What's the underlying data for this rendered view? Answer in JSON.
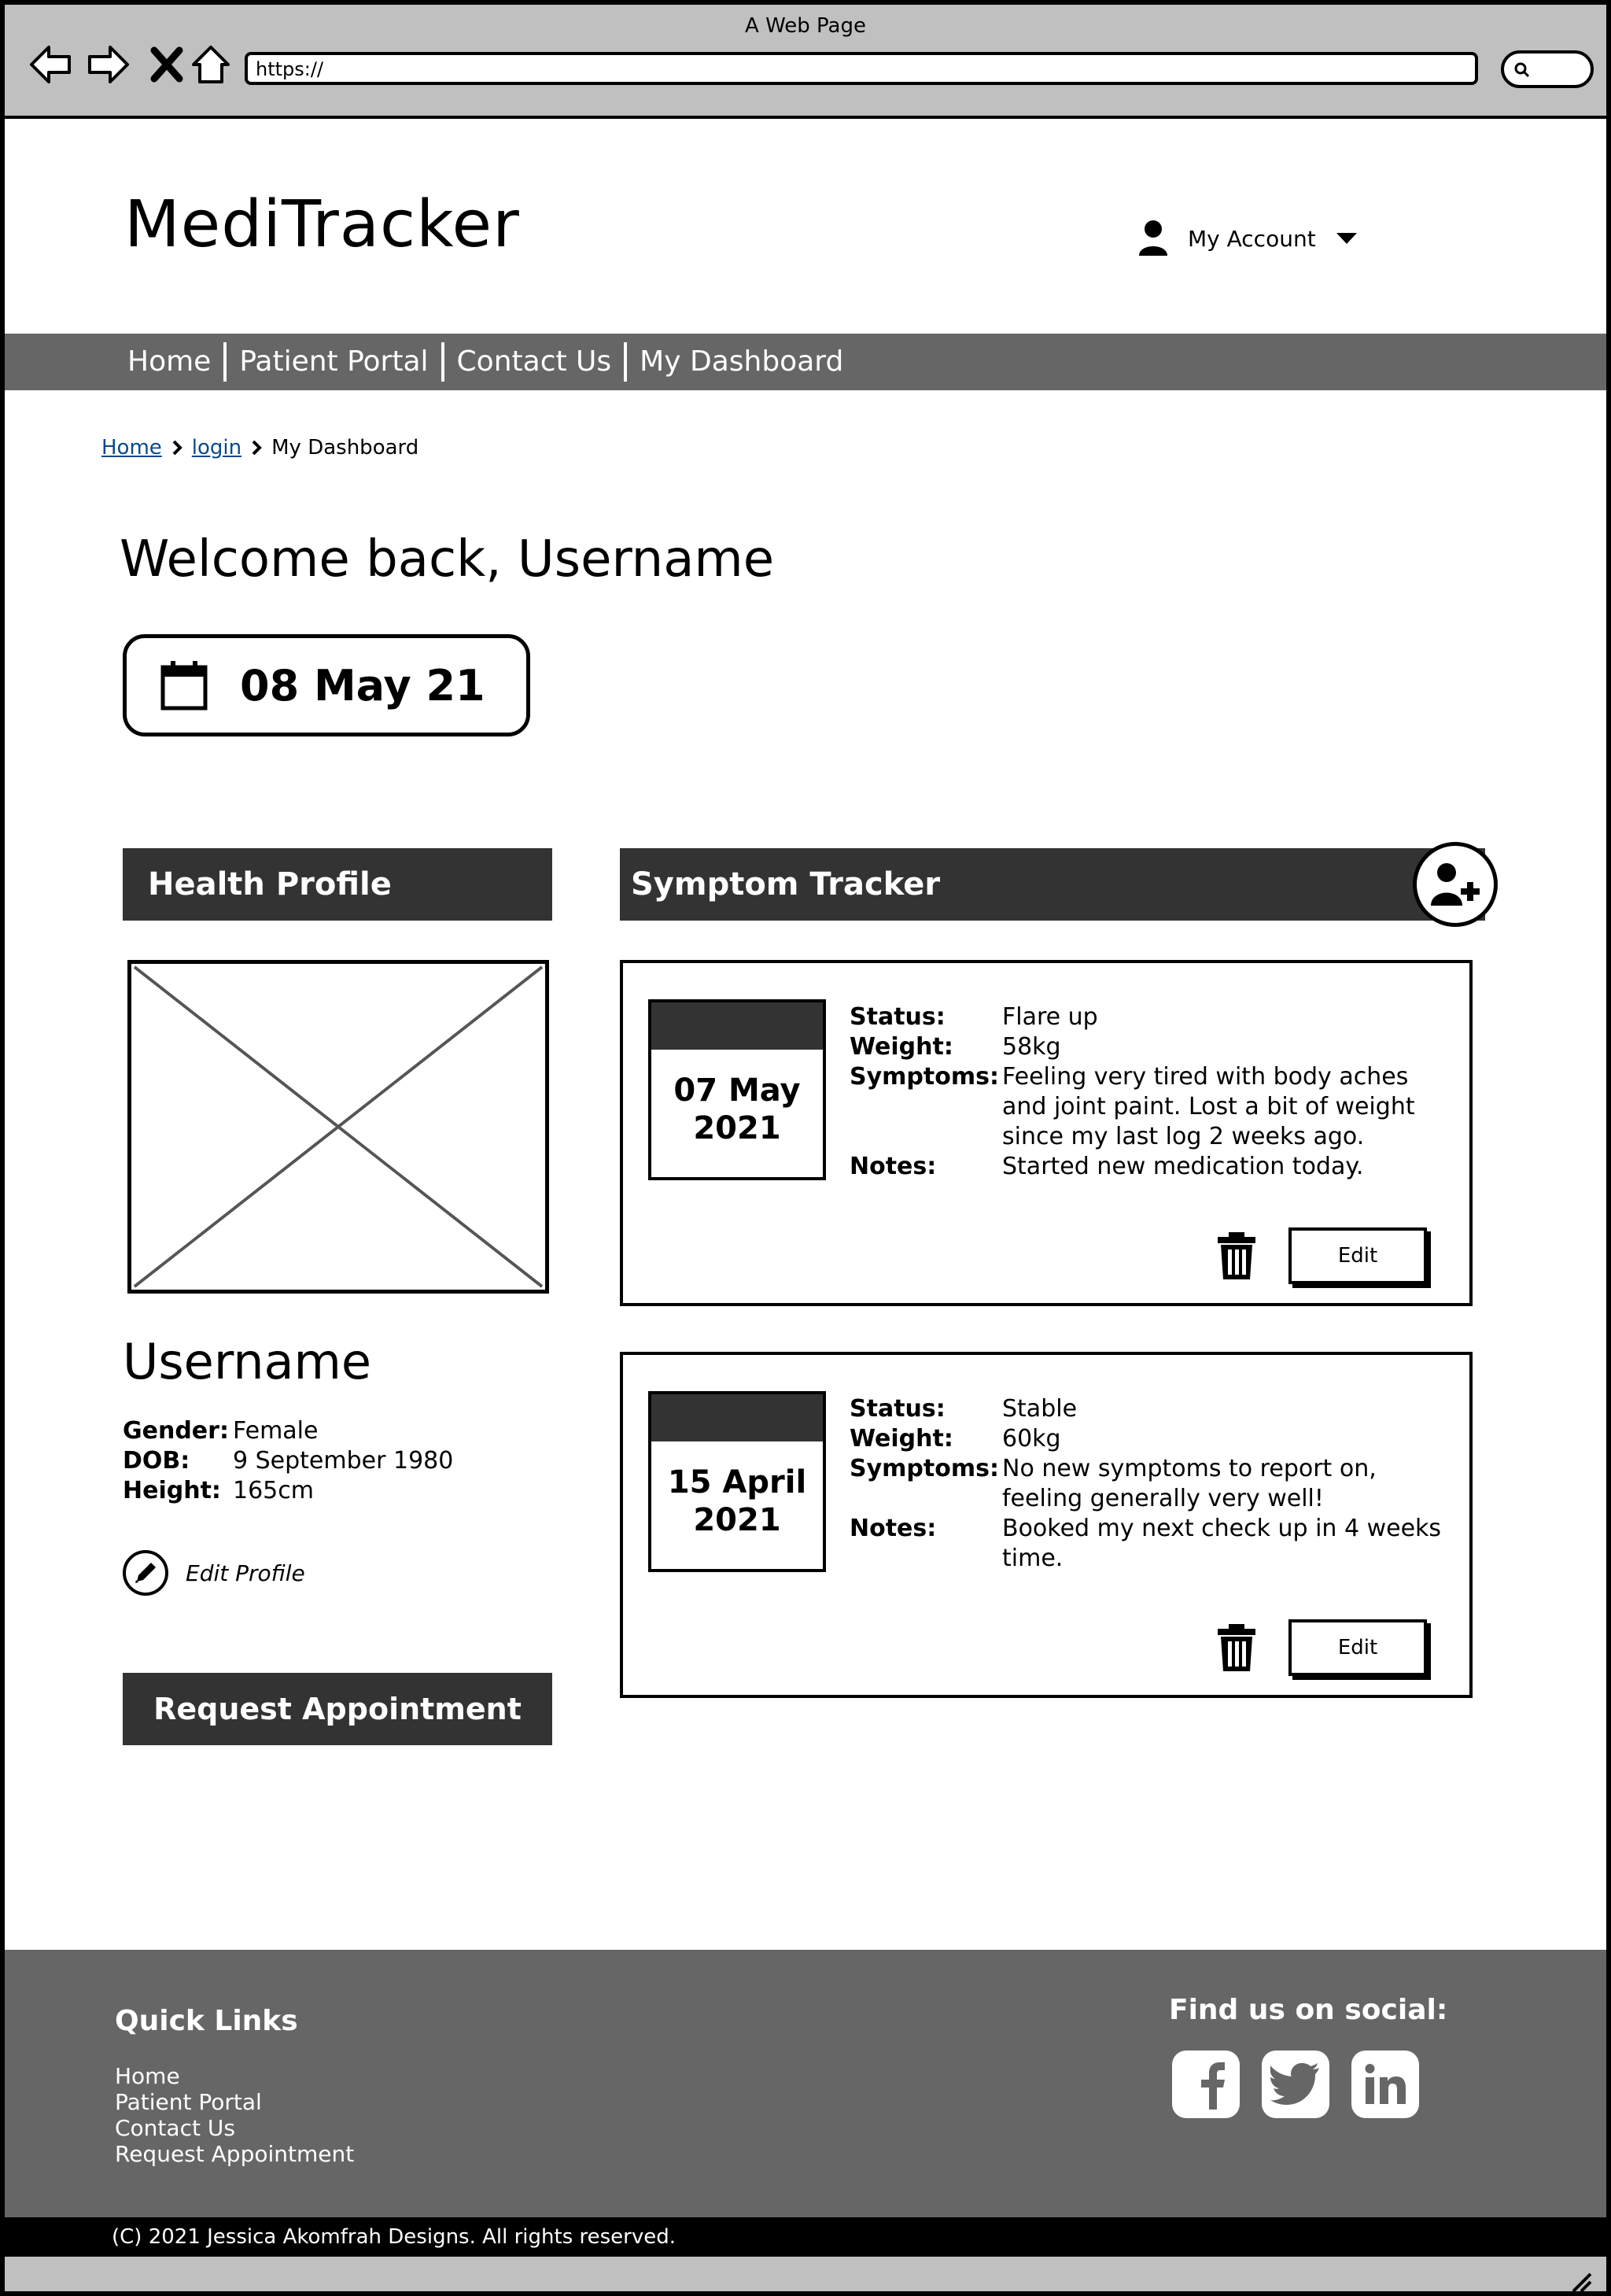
{
  "browser": {
    "title": "A Web Page",
    "url": "https://"
  },
  "header": {
    "logo": "MediTracker",
    "account_label": "My Account"
  },
  "nav": {
    "items": [
      "Home",
      "Patient Portal",
      "Contact Us",
      "My Dashboard"
    ]
  },
  "breadcrumb": {
    "items": [
      "Home",
      "login",
      "My Dashboard"
    ]
  },
  "welcome": "Welcome back, Username",
  "current_date": "08 May 21",
  "health_profile": {
    "title": "Health Profile",
    "username": "Username",
    "fields": [
      {
        "label": "Gender:",
        "value": "Female"
      },
      {
        "label": "DOB:",
        "value": "9 September 1980"
      },
      {
        "label": "Height:",
        "value": "165cm"
      }
    ],
    "edit_label": "Edit Profile",
    "request_button": "Request Appointment"
  },
  "symptom_tracker": {
    "title": "Symptom Tracker",
    "logs": [
      {
        "date_line1": "07 May",
        "date_line2": "2021",
        "status_label": "Status:",
        "status": "Flare up",
        "weight_label": "Weight:",
        "weight": "58kg",
        "symptoms_label": "Symptoms:",
        "symptoms": "Feeling very tired with body aches and joint paint. Lost a bit of weight since my last log 2 weeks ago.",
        "notes_label": "Notes:",
        "notes": "Started new medication today.",
        "edit_label": "Edit"
      },
      {
        "date_line1": "15 April",
        "date_line2": "2021",
        "status_label": "Status:",
        "status": "Stable",
        "weight_label": "Weight:",
        "weight": "60kg",
        "symptoms_label": "Symptoms:",
        "symptoms": "No new symptoms to report on, feeling generally very well!",
        "notes_label": "Notes:",
        "notes": "Booked my next check up in 4 weeks time.",
        "edit_label": "Edit"
      }
    ]
  },
  "footer": {
    "quick_links_title": "Quick Links",
    "quick_links": [
      "Home",
      "Patient Portal",
      "Contact Us",
      "Request Appointment"
    ],
    "social_title": "Find us on social:",
    "social_icons": [
      "facebook-icon",
      "twitter-icon",
      "linkedin-icon"
    ],
    "copyright": "(C) 2021 Jessica Akomfrah Designs. All rights reserved."
  }
}
